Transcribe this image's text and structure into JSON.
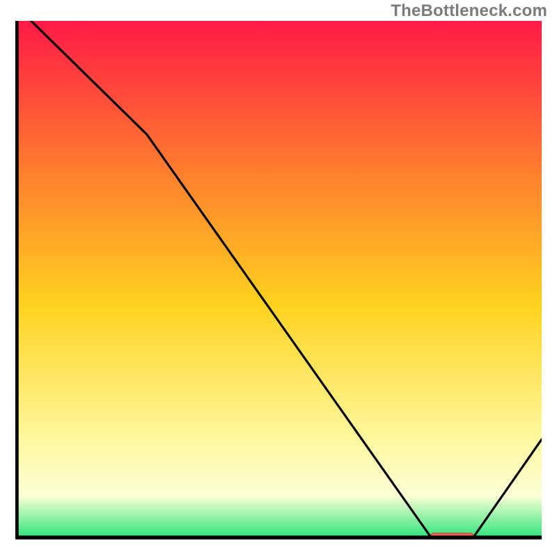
{
  "watermark": "TheBottleneck.com",
  "colors": {
    "curve": "#000000",
    "axis": "#000000",
    "marker_fill": "#e86a5d",
    "marker_stroke": "#d9463a",
    "grad_top": "#ff1a47",
    "grad_upper": "#ff7a2e",
    "grad_mid": "#ffd21f",
    "grad_lower": "#fff79a",
    "grad_pale": "#faffd6",
    "grad_green": "#2fe37a"
  },
  "chart_data": {
    "type": "line",
    "title": "",
    "xlabel": "",
    "ylabel": "",
    "xlim": [
      0,
      100
    ],
    "ylim": [
      0,
      100
    ],
    "grid": false,
    "legend": false,
    "x": [
      3,
      25,
      79,
      87,
      100
    ],
    "values": [
      100,
      78,
      0,
      0,
      19
    ],
    "marker": {
      "x_start": 79,
      "x_end": 87,
      "y": 0
    },
    "notes": "Gradient background from red (top) through orange, yellow, pale, to green (bottom). Single black curve descends from upper-left, flattens to zero near x≈79–87 where a short red marker sits, then rises toward the right edge."
  }
}
